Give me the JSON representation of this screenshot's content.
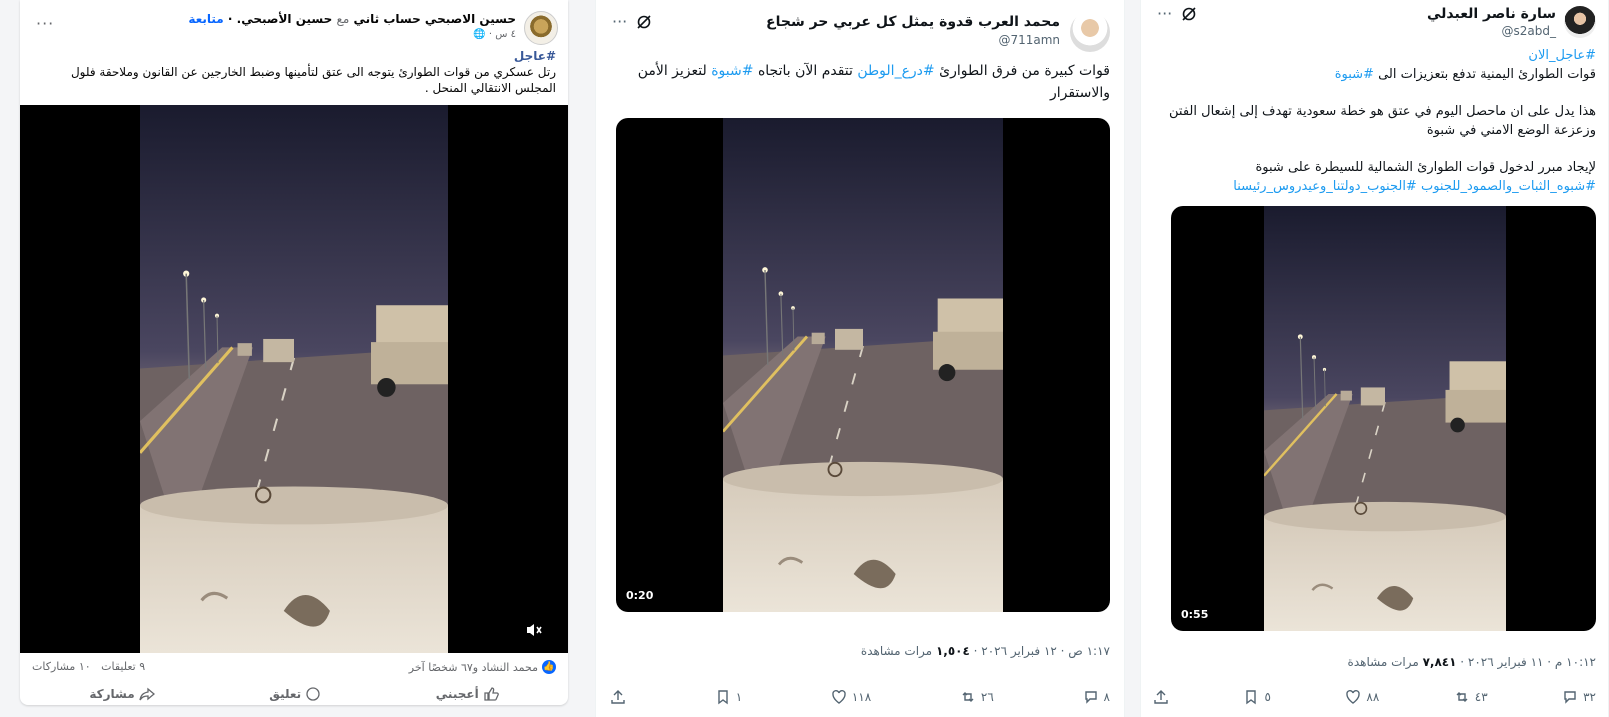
{
  "facebook_post": {
    "author": "حسين الاصبحي حساب ثاني",
    "with_text": "مع",
    "tagged": "حسين الأصبحي",
    "follow": "متابعة",
    "time": "٤ س",
    "hashtag": "#عاجل",
    "text": "رتل عسكري من قوات الطوارئ يتوجه الى عتق لتأمينها وضبط الخارجين عن القانون وملاحقة فلول المجلس الانتقالي المنحل .",
    "likers": "محمد النشاد و٦٧ شخصًا آخر",
    "comments": "٩ تعليقات",
    "shares": "١٠ مشاركات",
    "actions": {
      "like": "أعجبني",
      "comment": "تعليق",
      "share": "مشاركة"
    }
  },
  "tweet_middle": {
    "name": "محمد العرب قدوة يمثل كل عربي حر شجاع",
    "handle": "@711amn",
    "text_start": "قوات كبيرة من فرق الطوارئ",
    "tag1": "#درع_الوطن",
    "text_mid": "تتقدم الآن باتجاه",
    "tag2": "#شبوة",
    "text_end": "لتعزيز الأمن والاستقرار",
    "duration": "0:20",
    "timestamp": "١:١٧ ص · ١٢ فبراير ٢٠٢٦ ·",
    "views": "١,٥٠٤",
    "views_label": "مرات مشاهدة",
    "replies": "٨",
    "reposts": "٢٦",
    "likes": "١١٨",
    "bookmarks": "١"
  },
  "tweet_right": {
    "name": "سارة ناصر العبدلي",
    "handle": "@s2abd_",
    "tag_top": "#عاجل_الان",
    "line1": "قوات الطوارئ اليمنية تدفع بتعزيزات الى",
    "tag_shabwa": "#شبوة",
    "line2": "هذا يدل على ان ماحصل اليوم في عتق هو خطة سعودية تهدف إلى إشعال الفتن وزعزعة الوضع الامني في شبوة",
    "line3": "لإيجاد مبرر لدخول قوات الطوارئ الشمالية للسيطرة على شبوة",
    "tags_bottom": "#شبوه_الثبات_والصمود_للجنوب #الجنوب_دولتنا_وعيدروس_رئيسنا",
    "duration": "0:55",
    "timestamp": "١٠:١٢ م · ١١ فبراير ٢٠٢٦ ·",
    "views": "٧,٨٤١",
    "views_label": "مرات مشاهدة",
    "replies": "٣٢",
    "reposts": "٤٣",
    "likes": "٨٨",
    "bookmarks": "٥"
  },
  "colors": {
    "twitter_blue": "#1d9bf0",
    "facebook_blue": "#0866ff"
  }
}
